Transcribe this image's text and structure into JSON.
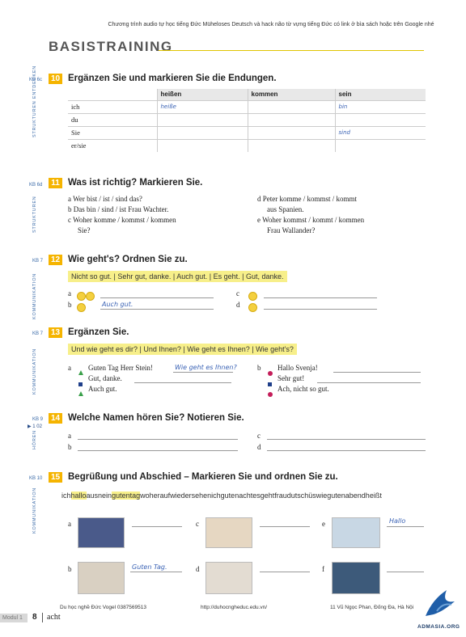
{
  "header": {
    "note": "Chương trình audio tự học tiếng Đức Müheloses Deutsch và hack não từ vựng tiếng Đức có link ở bìa sách hoặc trên Google nhé",
    "title": "BASISTRAINING"
  },
  "ex10": {
    "kb": "KB 6c",
    "num": "10",
    "side": "STRUKTUREN ENTDECKEN",
    "title": "Ergänzen Sie und markieren Sie die Endungen.",
    "columns": [
      "",
      "heißen",
      "kommen",
      "sein"
    ],
    "rows": [
      {
        "p": "ich",
        "a": "heiße",
        "b": "",
        "c": "bin"
      },
      {
        "p": "du",
        "a": "",
        "b": "",
        "c": ""
      },
      {
        "p": "Sie",
        "a": "",
        "b": "",
        "c": "sind"
      },
      {
        "p": "er/sie",
        "a": "",
        "b": "",
        "c": ""
      }
    ]
  },
  "ex11": {
    "kb": "KB 6d",
    "num": "11",
    "side": "STRUKTUREN",
    "title": "Was ist richtig? Markieren Sie.",
    "a": "a  Wer  bist / ist / sind  das?",
    "b": "b  Das  bin / sind / ist  Frau Wachter.",
    "c1": "c  Woher  komme / kommst / kommen",
    "c2": "Sie?",
    "d1": "d  Peter  komme / kommst / kommt",
    "d2": "aus Spanien.",
    "e1": "e  Woher  kommst / kommt / kommen",
    "e2": "Frau Wallander?"
  },
  "ex12": {
    "kb": "KB 7",
    "num": "12",
    "side": "KOMMUNIKATION",
    "title": "Wie geht's? Ordnen Sie zu.",
    "phrases": "Nicht so gut. | Sehr gut, danke. | Auch gut. | Es geht. | Gut, danke.",
    "la": "a",
    "lb": "b",
    "lc": "c",
    "ld": "d",
    "answer_b": "Auch gut."
  },
  "ex13": {
    "kb": "KB 7",
    "num": "13",
    "side": "KOMMUNIKATION",
    "title": "Ergänzen Sie.",
    "phrases": "Und wie geht es dir? | Und Ihnen? | Wie geht es Ihnen? | Wie geht's?",
    "la": "a",
    "a1": "Guten Tag Herr Stein!",
    "a1_answer": "Wie geht es Ihnen?",
    "a2": "Gut, danke.",
    "a3": "Auch gut.",
    "lb": "b",
    "b1": "Hallo Svenja!",
    "b2": "Sehr gut!",
    "b3": "Ach, nicht so gut."
  },
  "ex14": {
    "kb": "KB 9",
    "audio": "▶ 1 02",
    "num": "14",
    "side": "HÖREN",
    "title": "Welche Namen hören Sie? Notieren Sie.",
    "la": "a",
    "lb": "b",
    "lc": "c",
    "ld": "d"
  },
  "ex15": {
    "kb": "KB 10",
    "num": "15",
    "side": "KOMMUNIKATION",
    "title": "Begrüßung und Abschied – Markieren Sie und ordnen Sie zu.",
    "pre": "ich",
    "w1": "hallo",
    "mid": "ausnein",
    "w2": "gutentag",
    "rest": "woheraufwiedersehenichgutenachtesgehtfraudutschüswiegutenabendheißt",
    "la": "a",
    "lb": "b",
    "lc": "c",
    "ld": "d",
    "le": "e",
    "lf": "f",
    "answer_b": "Guten Tag.",
    "answer_e": "Hallo"
  },
  "footer": {
    "modul": "Modul 1",
    "page": "8",
    "pageword": "acht",
    "left": "Du học nghề Đức Vogel 0387569513",
    "center": "http://duhocngheduc.edu.vn/",
    "right": "11 Vũ Ngọc Phan, Đống Đa, Hà Nội",
    "logo": "ADMASIA.ORG"
  }
}
